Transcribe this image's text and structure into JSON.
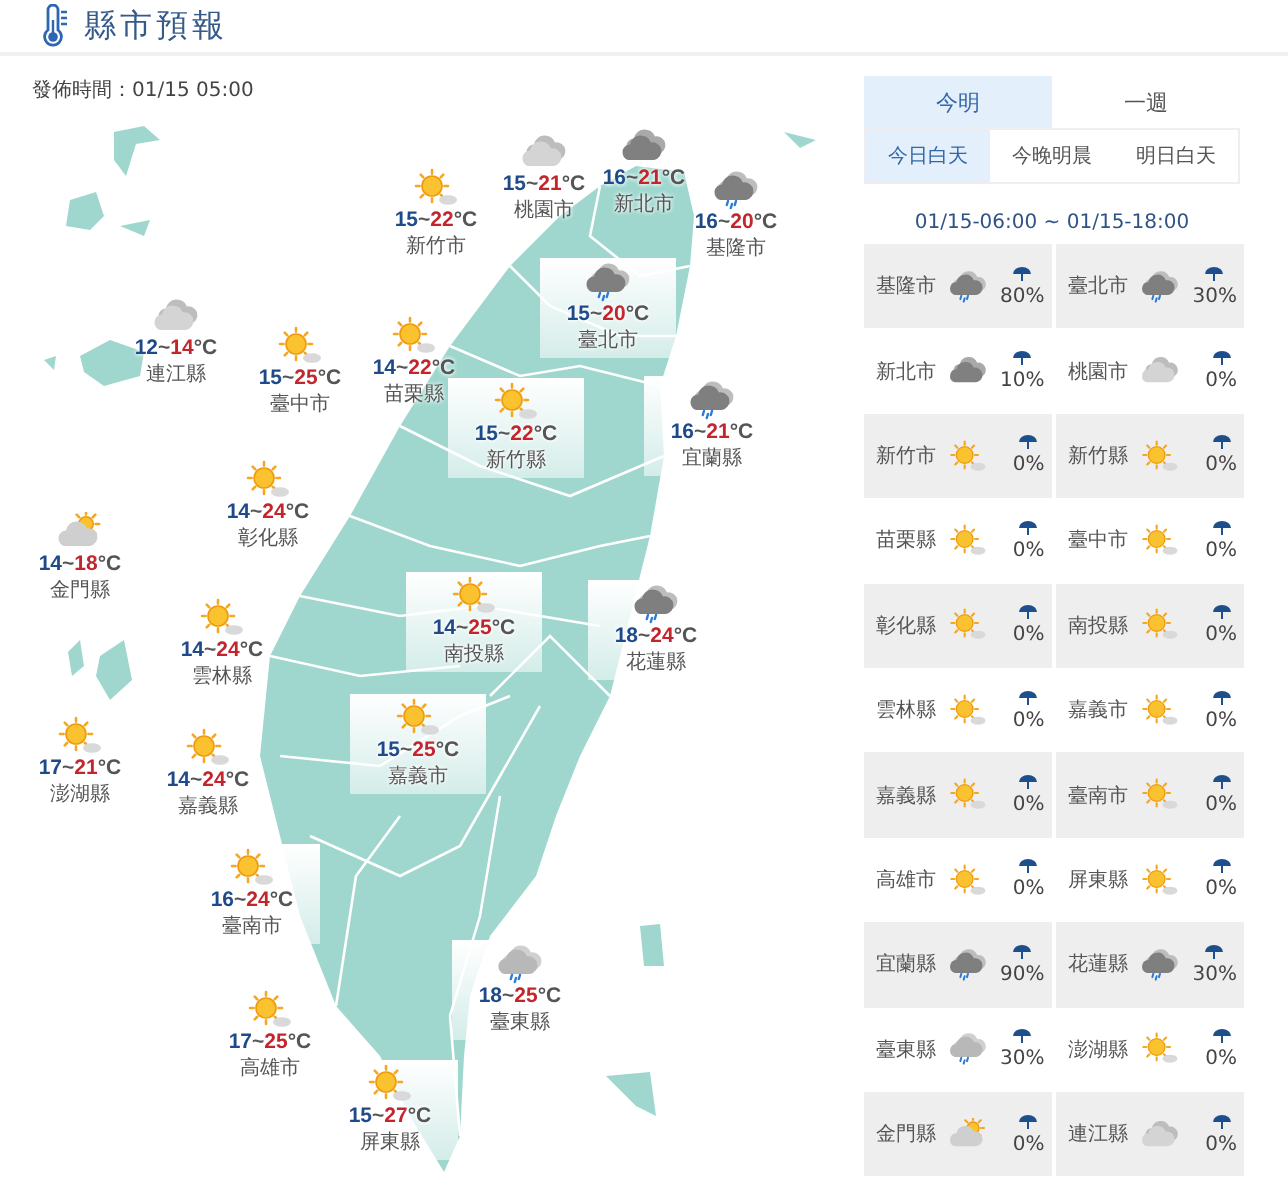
{
  "header": {
    "title": "縣市預報",
    "issued": "發佈時間：01/15 05:00"
  },
  "map": {
    "cities": [
      {
        "name": "新竹市",
        "low": "15",
        "sep": "~",
        "high": "22",
        "unit": "°C",
        "kind": "sunny"
      },
      {
        "name": "桃園市",
        "low": "15",
        "sep": "~",
        "high": "21",
        "unit": "°C",
        "kind": "cloudy"
      },
      {
        "name": "新北市",
        "low": "16",
        "sep": "~",
        "high": "21",
        "unit": "°C",
        "kind": "overcast"
      },
      {
        "name": "基隆市",
        "low": "16",
        "sep": "~",
        "high": "20",
        "unit": "°C",
        "kind": "rain"
      },
      {
        "name": "臺北市",
        "low": "15",
        "sep": "~",
        "high": "20",
        "unit": "°C",
        "kind": "rain"
      },
      {
        "name": "連江縣",
        "low": "12",
        "sep": "~",
        "high": "14",
        "unit": "°C",
        "kind": "cloudy"
      },
      {
        "name": "臺中市",
        "low": "15",
        "sep": "~",
        "high": "25",
        "unit": "°C",
        "kind": "sunny"
      },
      {
        "name": "苗栗縣",
        "low": "14",
        "sep": "~",
        "high": "22",
        "unit": "°C",
        "kind": "sunny"
      },
      {
        "name": "新竹縣",
        "low": "15",
        "sep": "~",
        "high": "22",
        "unit": "°C",
        "kind": "sunny"
      },
      {
        "name": "宜蘭縣",
        "low": "16",
        "sep": "~",
        "high": "21",
        "unit": "°C",
        "kind": "rain"
      },
      {
        "name": "彰化縣",
        "low": "14",
        "sep": "~",
        "high": "24",
        "unit": "°C",
        "kind": "sunny"
      },
      {
        "name": "金門縣",
        "low": "14",
        "sep": "~",
        "high": "18",
        "unit": "°C",
        "kind": "partly"
      },
      {
        "name": "南投縣",
        "low": "14",
        "sep": "~",
        "high": "25",
        "unit": "°C",
        "kind": "sunny"
      },
      {
        "name": "花蓮縣",
        "low": "18",
        "sep": "~",
        "high": "24",
        "unit": "°C",
        "kind": "rain"
      },
      {
        "name": "雲林縣",
        "low": "14",
        "sep": "~",
        "high": "24",
        "unit": "°C",
        "kind": "sunny"
      },
      {
        "name": "澎湖縣",
        "low": "17",
        "sep": "~",
        "high": "21",
        "unit": "°C",
        "kind": "sunny"
      },
      {
        "name": "嘉義市",
        "low": "15",
        "sep": "~",
        "high": "25",
        "unit": "°C",
        "kind": "sunny"
      },
      {
        "name": "嘉義縣",
        "low": "14",
        "sep": "~",
        "high": "24",
        "unit": "°C",
        "kind": "sunny"
      },
      {
        "name": "臺南市",
        "low": "16",
        "sep": "~",
        "high": "24",
        "unit": "°C",
        "kind": "sunny"
      },
      {
        "name": "臺東縣",
        "low": "18",
        "sep": "~",
        "high": "25",
        "unit": "°C",
        "kind": "shower"
      },
      {
        "name": "高雄市",
        "low": "17",
        "sep": "~",
        "high": "25",
        "unit": "°C",
        "kind": "sunny"
      },
      {
        "name": "屏東縣",
        "low": "15",
        "sep": "~",
        "high": "27",
        "unit": "°C",
        "kind": "sunny"
      }
    ]
  },
  "forecast": {
    "tabs": [
      {
        "label": "今明",
        "selected": true
      },
      {
        "label": "一週",
        "selected": false
      }
    ],
    "periods": [
      {
        "label": "今日白天",
        "selected": true
      },
      {
        "label": "今晚明晨",
        "selected": false
      },
      {
        "label": "明日白天",
        "selected": false
      }
    ],
    "range": "01/15-06:00 ~ 01/15-18:00",
    "rows": [
      {
        "name": "基隆市",
        "kind": "rain",
        "pop": "80%"
      },
      {
        "name": "臺北市",
        "kind": "rain",
        "pop": "30%"
      },
      {
        "name": "新北市",
        "kind": "overcast",
        "pop": "10%"
      },
      {
        "name": "桃園市",
        "kind": "cloudy",
        "pop": "0%"
      },
      {
        "name": "新竹市",
        "kind": "sunny",
        "pop": "0%"
      },
      {
        "name": "新竹縣",
        "kind": "sunny",
        "pop": "0%"
      },
      {
        "name": "苗栗縣",
        "kind": "sunny",
        "pop": "0%"
      },
      {
        "name": "臺中市",
        "kind": "sunny",
        "pop": "0%"
      },
      {
        "name": "彰化縣",
        "kind": "sunny",
        "pop": "0%"
      },
      {
        "name": "南投縣",
        "kind": "sunny",
        "pop": "0%"
      },
      {
        "name": "雲林縣",
        "kind": "sunny",
        "pop": "0%"
      },
      {
        "name": "嘉義市",
        "kind": "sunny",
        "pop": "0%"
      },
      {
        "name": "嘉義縣",
        "kind": "sunny",
        "pop": "0%"
      },
      {
        "name": "臺南市",
        "kind": "sunny",
        "pop": "0%"
      },
      {
        "name": "高雄市",
        "kind": "sunny",
        "pop": "0%"
      },
      {
        "name": "屏東縣",
        "kind": "sunny",
        "pop": "0%"
      },
      {
        "name": "宜蘭縣",
        "kind": "rain",
        "pop": "90%"
      },
      {
        "name": "花蓮縣",
        "kind": "rain",
        "pop": "30%"
      },
      {
        "name": "臺東縣",
        "kind": "shower",
        "pop": "30%"
      },
      {
        "name": "澎湖縣",
        "kind": "sunny",
        "pop": "0%"
      },
      {
        "name": "金門縣",
        "kind": "partly",
        "pop": "0%"
      },
      {
        "name": "連江縣",
        "kind": "cloudy",
        "pop": "0%"
      }
    ]
  }
}
